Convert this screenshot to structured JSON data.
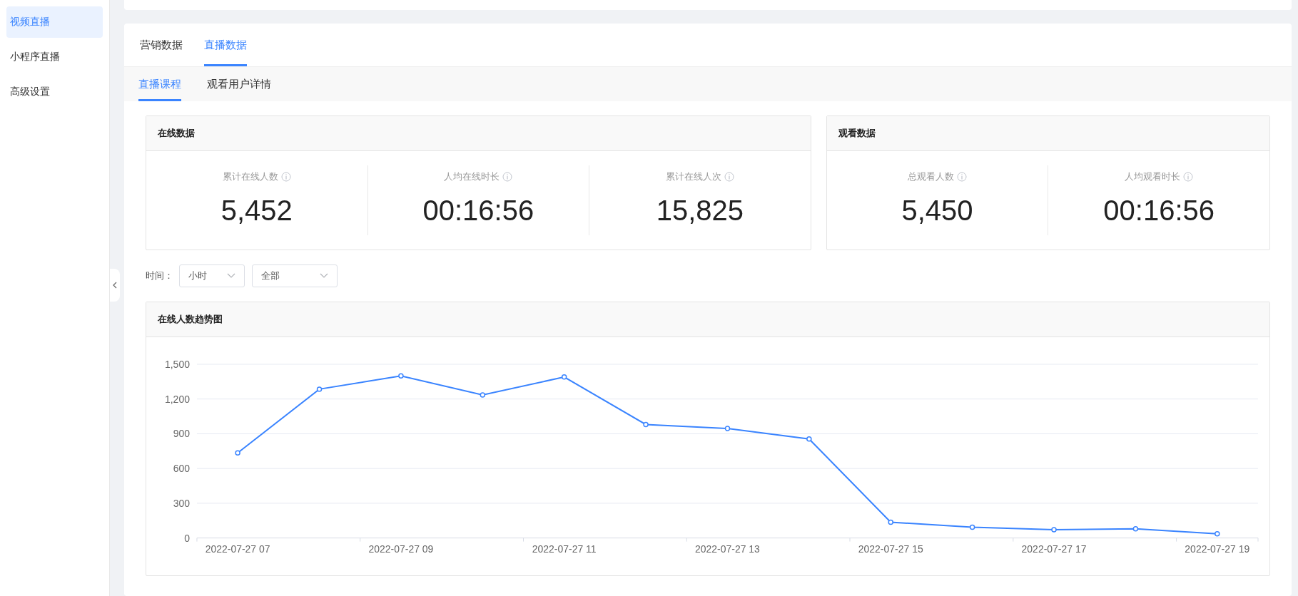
{
  "sidebar": {
    "items": [
      {
        "label": "视频直播",
        "selected": true
      },
      {
        "label": "小程序直播",
        "selected": false
      },
      {
        "label": "高级设置",
        "selected": false
      }
    ]
  },
  "tabs": [
    {
      "label": "营销数据",
      "selected": false
    },
    {
      "label": "直播数据",
      "selected": true
    }
  ],
  "sub_tabs": [
    {
      "label": "直播课程",
      "selected": true
    },
    {
      "label": "观看用户详情",
      "selected": false
    }
  ],
  "stat_panels": [
    {
      "title": "在线数据",
      "stats": [
        {
          "label": "累计在线人数",
          "value": "5,452"
        },
        {
          "label": "人均在线时长",
          "value": "00:16:56"
        },
        {
          "label": "累计在线人次",
          "value": "15,825"
        }
      ]
    },
    {
      "title": "观看数据",
      "stats": [
        {
          "label": "总观看人数",
          "value": "5,450"
        },
        {
          "label": "人均观看时长",
          "value": "00:16:56"
        }
      ]
    }
  ],
  "filter": {
    "label": "时间：",
    "selects": [
      {
        "value": "小时"
      },
      {
        "value": "全部"
      }
    ]
  },
  "chart_panel": {
    "title": "在线人数趋势图",
    "chart_data": {
      "type": "line",
      "categories": [
        "2022-07-27 07",
        null,
        "2022-07-27 09",
        null,
        "2022-07-27 11",
        null,
        "2022-07-27 13",
        null,
        "2022-07-27 15",
        null,
        "2022-07-27 17",
        null,
        "2022-07-27 19"
      ],
      "grid": true,
      "series": [
        {
          "color": "#3a84ff",
          "marker": "circle",
          "values": [
            735,
            1285,
            1400,
            1235,
            1390,
            980,
            945,
            855,
            136,
            93,
            71,
            79,
            36
          ]
        }
      ],
      "ylim": [
        0,
        1500
      ],
      "yticks": [
        {
          "value": 0,
          "label": "0"
        },
        {
          "value": 300,
          "label": "300"
        },
        {
          "value": 600,
          "label": "600"
        },
        {
          "value": 900,
          "label": "900"
        },
        {
          "value": 1200,
          "label": "1,200"
        },
        {
          "value": 1500,
          "label": "1,500"
        }
      ]
    }
  }
}
